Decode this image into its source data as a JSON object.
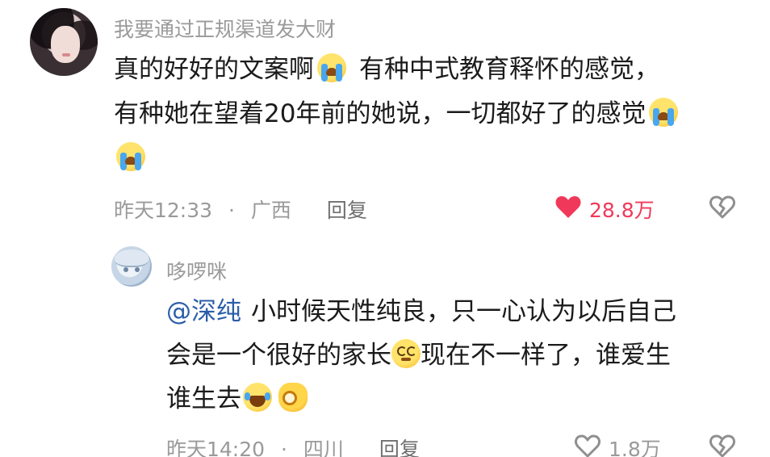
{
  "comment": {
    "username": "我要通过正规渠道发大财",
    "lines": [
      {
        "before": "真的好好的文案啊",
        "after": "有种中式教育释怀的感觉，"
      },
      {
        "before": "有种她在望着20年前的她说，一切都好了的感觉",
        "after": ""
      }
    ],
    "time": "昨天12:33",
    "separator": "·",
    "location": "广西",
    "reply_label": "回复",
    "like_count": "28.8万",
    "liked": true
  },
  "reply": {
    "username": "哆啰咪",
    "mention": "@深纯",
    "line1": "小时候天性纯良，只一心认为以后自己",
    "line2_before": "会是一个很好的家长",
    "line2_after": "现在不一样了，谁爱生",
    "line3": "谁生去",
    "time": "昨天14:20",
    "separator": "·",
    "location": "四川",
    "reply_label": "回复",
    "like_count": "1.8万",
    "liked": false
  },
  "icons": {
    "emoji_cry": "loudly-crying-face-icon",
    "emoji_dizzy": "woozy-face-icon",
    "emoji_laugh": "rolling-laughing-face-icon",
    "emoji_ok": "ok-hand-icon",
    "like": "heart-icon",
    "dislike": "broken-heart-icon"
  },
  "colors": {
    "like_active": "#f0395a",
    "meta_text": "#9a9a9a",
    "mention": "#2b5da8"
  }
}
